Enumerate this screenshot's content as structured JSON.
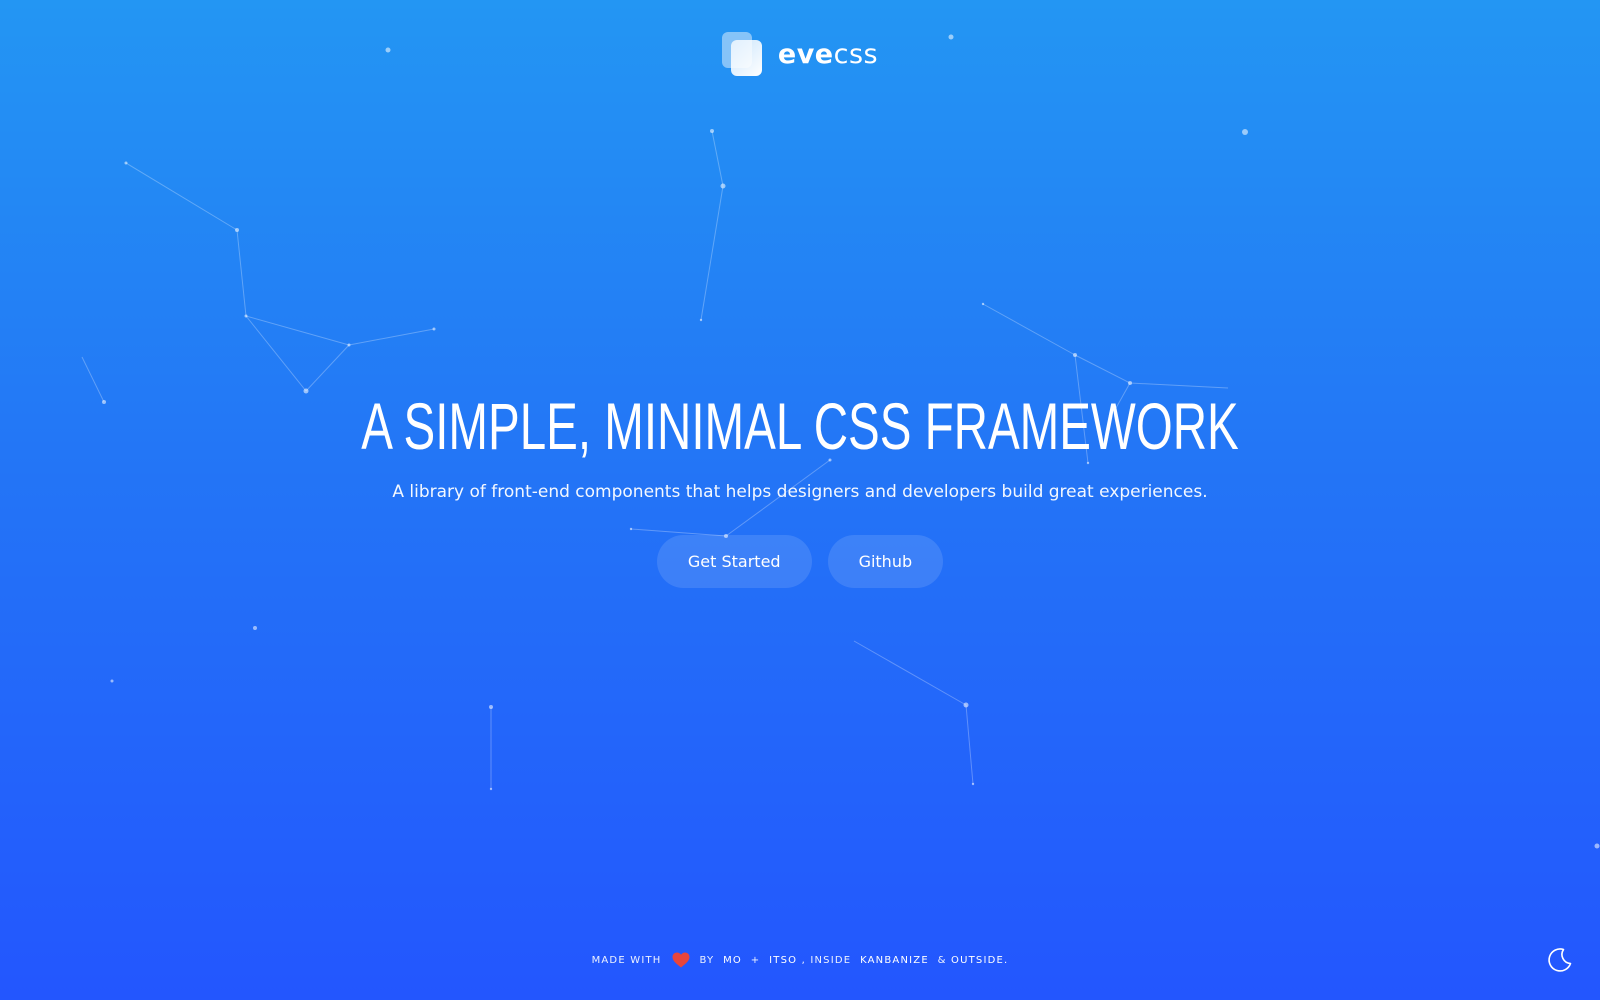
{
  "header": {
    "brand_bold": "eve",
    "brand_light": "css"
  },
  "hero": {
    "title": "A SIMPLE, MINIMAL CSS FRAMEWORK",
    "subtitle": "A library of front-end components that helps designers and developers build great experiences.",
    "primary_button": "Get Started",
    "secondary_button": "Github"
  },
  "footer": {
    "made_with": "MADE WITH",
    "heart_icon": "heart-icon",
    "by": "BY",
    "author_1": "MO",
    "plus": "+",
    "author_2": "ITSO",
    "inside": ", INSIDE",
    "company": "KANBANIZE",
    "ampersand": "&",
    "outside": "OUTSIDE.",
    "heart_color": "#e8453c"
  },
  "theme_toggle": {
    "icon": "moon-icon"
  },
  "colors": {
    "background_top": "#2396f3",
    "background_bottom": "#2356fe",
    "text": "#ffffff"
  }
}
